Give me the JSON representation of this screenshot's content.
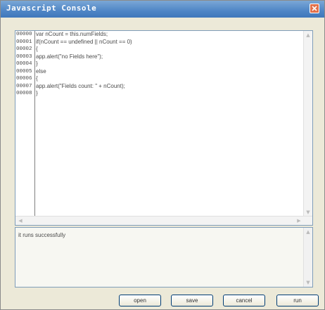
{
  "window": {
    "title": "Javascript Console"
  },
  "icons": {
    "close": "close-icon",
    "scroll_up": "arrow-up-icon",
    "scroll_down": "arrow-down-icon",
    "scroll_left": "arrow-left-icon",
    "scroll_right": "arrow-right-icon"
  },
  "editor": {
    "line_numbers": [
      "00000",
      "00001",
      "00002",
      "00003",
      "00004",
      "00005",
      "00006",
      "00007",
      "00008"
    ],
    "lines": [
      "var nCount = this.numFields;",
      "if(nCount == undefined || nCount == 0)",
      "{",
      "app.alert(\"no Fields here\");",
      "}",
      "else",
      "{",
      "app.alert(\"Fields count: \" + nCount);",
      "}"
    ]
  },
  "output": {
    "text": "it runs successfully"
  },
  "buttons": {
    "open": "open",
    "save": "save",
    "cancel": "cancel",
    "run": "run"
  },
  "colors": {
    "titlebar": "#4f86c6",
    "close": "#e2704a",
    "border": "#7f9db9"
  }
}
